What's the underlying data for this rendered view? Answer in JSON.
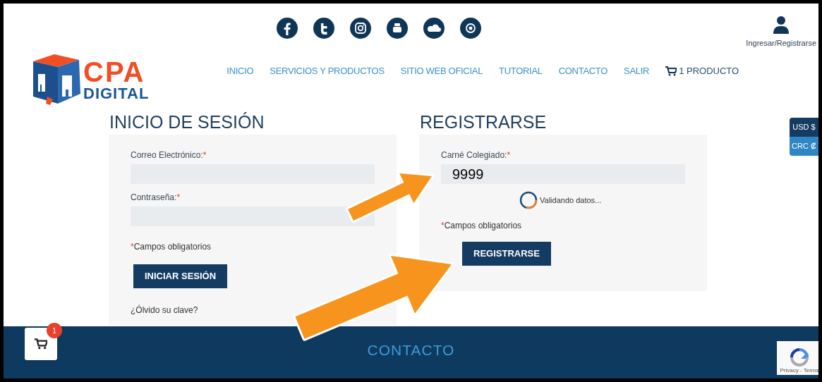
{
  "social_icons": [
    {
      "kind": "facebook"
    },
    {
      "kind": "twitter"
    },
    {
      "kind": "instagram"
    },
    {
      "kind": "youtube"
    },
    {
      "kind": "soundcloud"
    },
    {
      "kind": "camera"
    }
  ],
  "account": {
    "label": "Ingresar/Registrarse"
  },
  "logo": {
    "line1": "CPA",
    "line2": "DIGITAL"
  },
  "nav": [
    {
      "label": "INICIO",
      "kind": "link"
    },
    {
      "label": "SERVICIOS Y PRODUCTOS",
      "kind": "link"
    },
    {
      "label": "SITIO WEB OFICIAL",
      "kind": "link"
    },
    {
      "label": "TUTORIAL",
      "kind": "link"
    },
    {
      "label": "CONTACTO",
      "kind": "link"
    },
    {
      "label": "SALIR",
      "kind": "link"
    },
    {
      "label": "1 PRODUCTO",
      "kind": "cart"
    }
  ],
  "login": {
    "title": "INICIO DE SESIÓN",
    "fields": [
      {
        "label": "Correo Electrónico:",
        "marker": "*"
      },
      {
        "label": "Contraseña:",
        "marker": "*"
      }
    ],
    "note_marker": "*",
    "note": "Campos obligatorios",
    "button": "INICIAR SESIÓN",
    "link": "¿Ólvido su clave?"
  },
  "register": {
    "title": "REGISTRARSE",
    "fields": [
      {
        "label": "Carné Colegiado:",
        "marker": "*",
        "value": "9999"
      }
    ],
    "status": "Validando datos...",
    "note_marker": "*",
    "note": "Campos obligatorios",
    "button": "REGISTRARSE"
  },
  "currencies": [
    {
      "label": "USD $",
      "selected": true
    },
    {
      "label": "CRC ₡",
      "selected": false
    }
  ],
  "floating_cart": {
    "count": "1"
  },
  "footer": {
    "title": "CONTACTO"
  },
  "recaptcha": {
    "text": "Privacy - Terms"
  }
}
